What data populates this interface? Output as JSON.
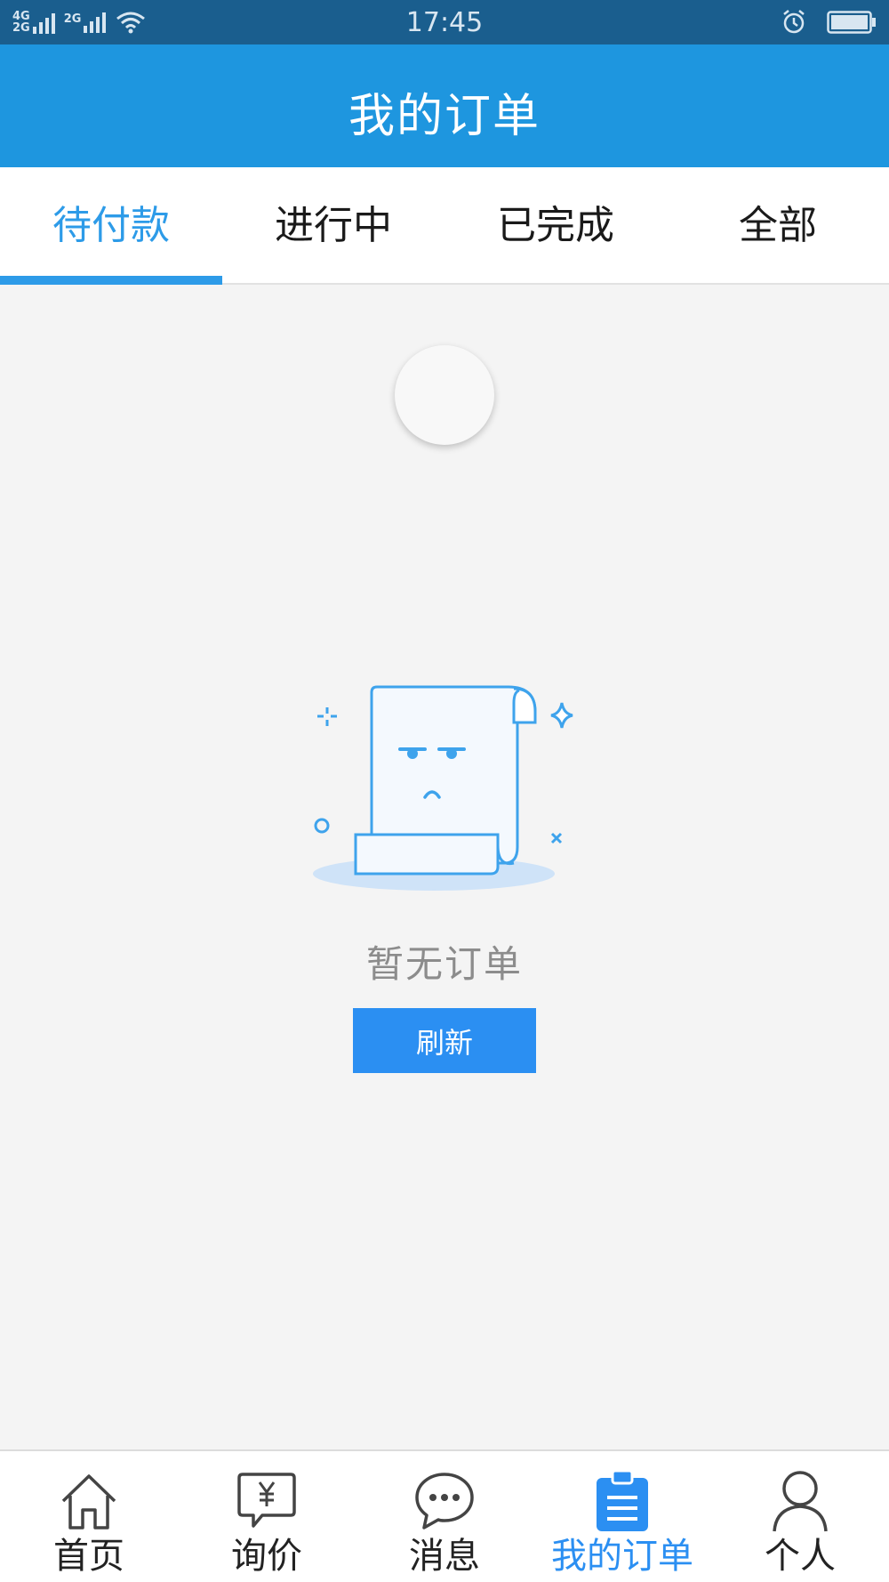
{
  "status_bar": {
    "time": "17:45",
    "network_left": "4G",
    "network_left_sub": "2G",
    "network_right": "2G"
  },
  "app_bar": {
    "title": "我的订单"
  },
  "tabs": [
    {
      "label": "待付款",
      "active": true
    },
    {
      "label": "进行中",
      "active": false
    },
    {
      "label": "已完成",
      "active": false
    },
    {
      "label": "全部",
      "active": false
    }
  ],
  "empty_state": {
    "message": "暂无订单",
    "refresh_label": "刷新"
  },
  "bottom_nav": [
    {
      "label": "首页",
      "icon": "home-icon",
      "active": false
    },
    {
      "label": "询价",
      "icon": "inquiry-icon",
      "active": false
    },
    {
      "label": "消息",
      "icon": "message-icon",
      "active": false
    },
    {
      "label": "我的订单",
      "icon": "orders-icon",
      "active": true
    },
    {
      "label": "个人",
      "icon": "person-icon",
      "active": false
    }
  ],
  "colors": {
    "status_bar": "#1a5e8e",
    "app_bar": "#1e96df",
    "accent": "#2d9be8",
    "button": "#2b8ff2",
    "background": "#f4f4f4"
  }
}
